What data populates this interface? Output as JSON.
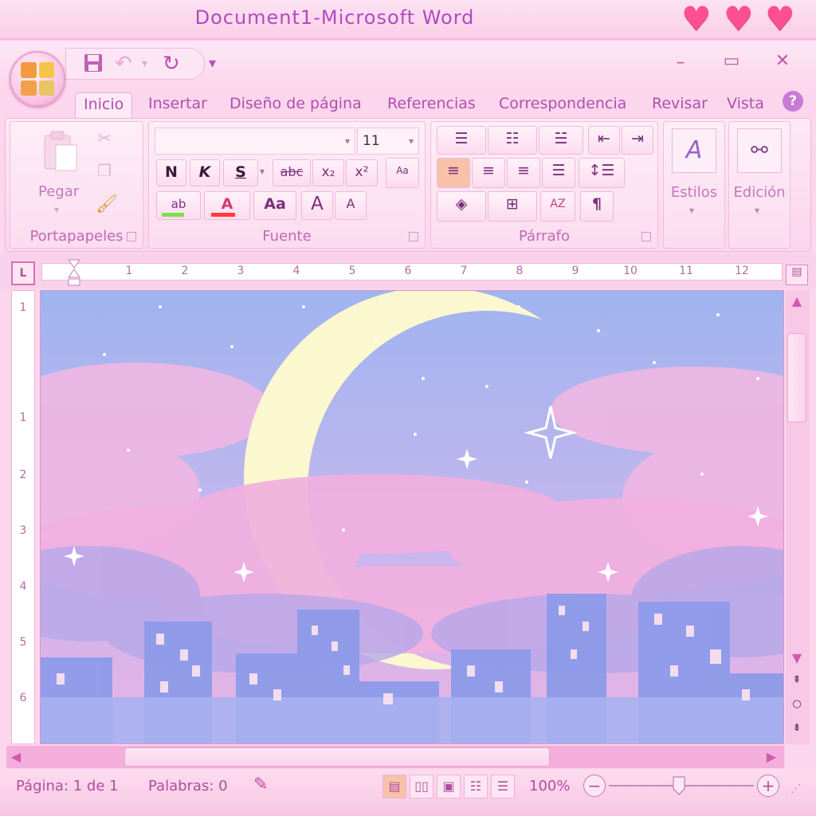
{
  "window": {
    "title": "Document1-Microsoft Word",
    "heart_glyph": "♥"
  },
  "quick_access": {
    "save_icon": "save-icon",
    "undo_icon": "undo-icon",
    "redo_icon": "redo-icon",
    "customize_glyph": "▾"
  },
  "window_controls": {
    "minimize": "–",
    "maximize": "▭",
    "close": "✕"
  },
  "tabs": [
    "Inicio",
    "Insertar",
    "Diseño de página",
    "Referencias",
    "Correspondencia",
    "Revisar",
    "Vista"
  ],
  "help_label": "?",
  "ribbon": {
    "clipboard": {
      "label": "Portapapeles",
      "paste_label": "Pegar"
    },
    "font": {
      "label": "Fuente",
      "font_name": "",
      "font_size": "11",
      "bold": "N",
      "italic": "K",
      "underline": "S",
      "strike": "abc",
      "subscript": "x₂",
      "superscript": "x²",
      "highlight": "ab",
      "font_color": "A",
      "change_case": "Aa",
      "grow": "A",
      "shrink": "A",
      "clear": "Aa"
    },
    "paragraph": {
      "label": "Párrafo",
      "pilcrow": "¶",
      "sort": "AZ"
    },
    "styles": {
      "label": "Estilos",
      "icon_glyph": "A"
    },
    "editing": {
      "label": "Edición"
    }
  },
  "ruler": {
    "tab_marker": "L",
    "marks": [
      "1",
      "1",
      "2",
      "3",
      "4",
      "5",
      "6",
      "7",
      "8",
      "9",
      "10",
      "11",
      "12"
    ],
    "vertical_marks": [
      "1",
      "1",
      "2",
      "3",
      "4",
      "5",
      "6"
    ]
  },
  "status_bar": {
    "page": "Página: 1 de 1",
    "words": "Palabras: 0",
    "zoom": "100%",
    "zoom_minus": "−",
    "zoom_plus": "+"
  },
  "colors": {
    "accent": "#b04fa0",
    "title": "#b04bc0",
    "heart": "#ff4f93",
    "highlight_bar": "#7be24a",
    "font_color_bar": "#ff3c3c"
  }
}
